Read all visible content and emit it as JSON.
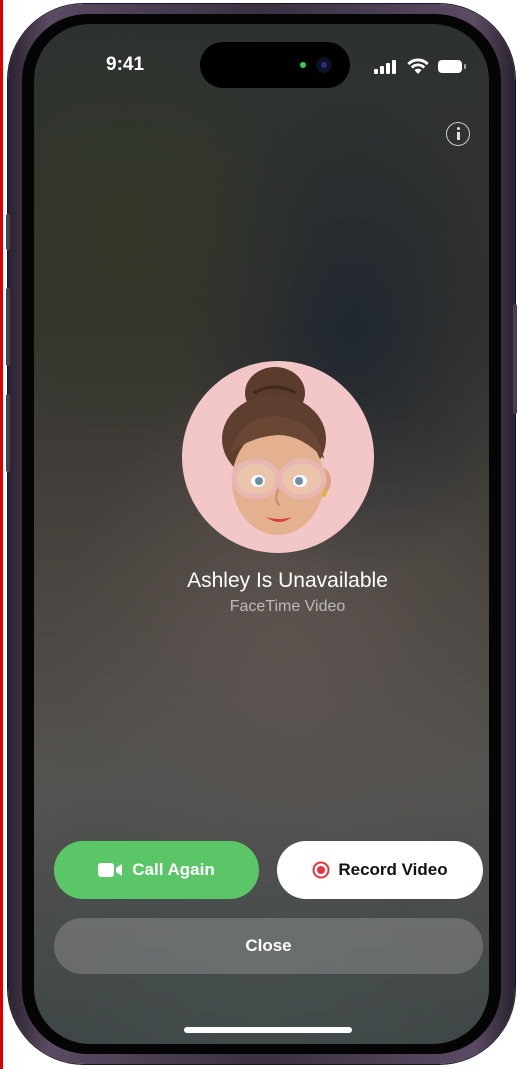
{
  "status_bar": {
    "time": "9:41",
    "icons": [
      "signal-icon",
      "wifi-icon",
      "battery-icon"
    ]
  },
  "info_button": {
    "icon": "info-icon"
  },
  "caller": {
    "name_line": "Ashley Is Unavailable",
    "call_type": "FaceTime Video",
    "avatar": "memoji-avatar"
  },
  "actions": {
    "call_again": {
      "label": "Call Again",
      "icon": "video-camera-icon",
      "color": "#5BC667"
    },
    "record_video": {
      "label": "Record Video",
      "icon": "record-icon",
      "color": "#E8323C"
    },
    "close": {
      "label": "Close"
    }
  },
  "colors": {
    "call_green": "#5BC667",
    "record_red": "#E8323C",
    "avatar_background": "#F3C7C8"
  }
}
